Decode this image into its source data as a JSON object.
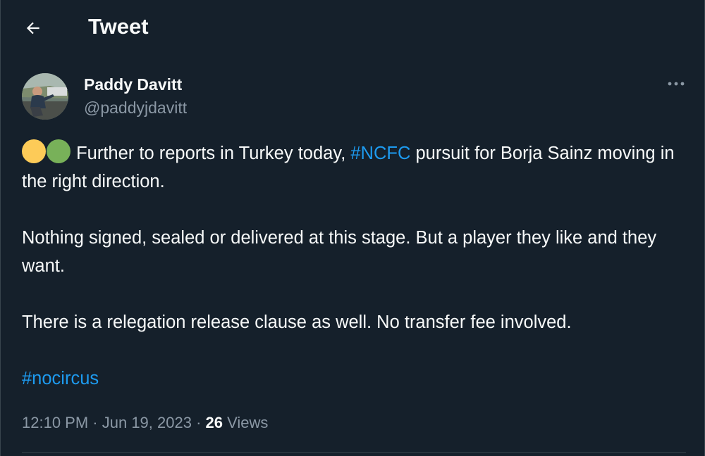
{
  "header": {
    "title": "Tweet",
    "back_icon": "arrow-left-icon"
  },
  "author": {
    "name": "Paddy Davitt",
    "handle": "@paddyjdavitt",
    "avatar_icon": "profile-photo"
  },
  "more_icon": "ellipsis-horizontal-icon",
  "tweet": {
    "emoji_1_color": "#fdcb58",
    "emoji_2_color": "#78b159",
    "line1_before": " Further to reports in Turkey today, ",
    "hashtag_1": "#NCFC",
    "line1_after": " pursuit for Borja Sainz moving in the right direction.",
    "paragraph_2": "Nothing signed, sealed or delivered at this stage. But a player they like and they want.",
    "paragraph_3": "There is a relegation release clause as well. No transfer fee involved.",
    "hashtag_2": "#nocircus"
  },
  "meta": {
    "time": "12:10 PM",
    "separator_1": " · ",
    "date": "Jun 19, 2023",
    "separator_2": " · ",
    "views_count": "26",
    "views_label": " Views"
  },
  "colors": {
    "background": "#15202b",
    "accent": "#1d9bf0",
    "secondary_text": "#8b98a5",
    "divider": "#38444d"
  }
}
